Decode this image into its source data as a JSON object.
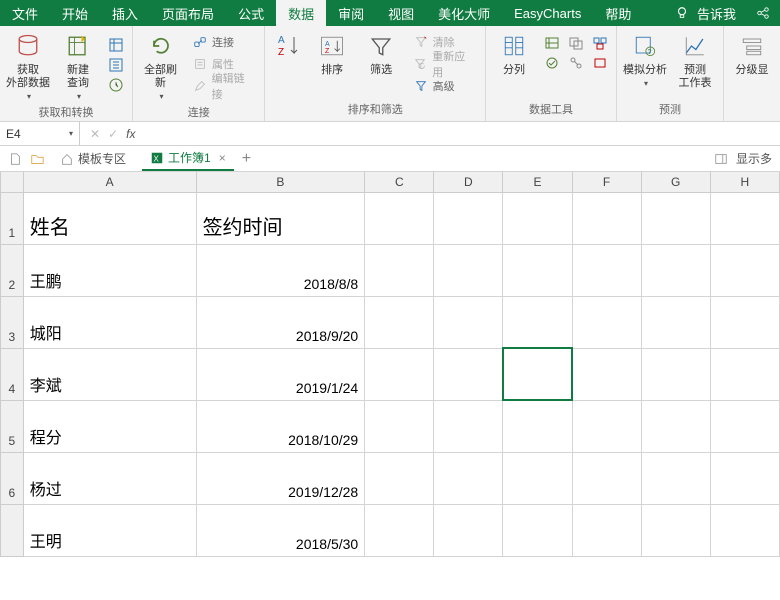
{
  "menu": {
    "tabs": [
      "文件",
      "开始",
      "插入",
      "页面布局",
      "公式",
      "数据",
      "审阅",
      "视图",
      "美化大师",
      "EasyCharts",
      "帮助"
    ],
    "active_index": 5,
    "tell_me": "告诉我"
  },
  "ribbon": {
    "group1": {
      "btn_external": "获取\n外部数据",
      "btn_newquery": "新建\n查询",
      "label": "获取和转换"
    },
    "group2": {
      "btn_refresh": "全部刷新",
      "itm_conn": "连接",
      "itm_prop": "属性",
      "itm_edit": "编辑链接",
      "label": "连接"
    },
    "group3": {
      "btn_sort": "排序",
      "btn_filter": "筛选",
      "itm_clear": "清除",
      "itm_reapply": "重新应用",
      "itm_adv": "高级",
      "label": "排序和筛选"
    },
    "group4": {
      "btn_split": "分列",
      "label": "数据工具"
    },
    "group5": {
      "btn_whatif": "模拟分析",
      "btn_forecast": "预测\n工作表",
      "label": "预测"
    },
    "group6": {
      "btn_group": "分级显",
      "label": ""
    }
  },
  "namebox": "E4",
  "doctabs": {
    "templates": "模板专区",
    "workbook": "工作簿1",
    "showmore": "显示多"
  },
  "columns": [
    "A",
    "B",
    "C",
    "D",
    "E",
    "F",
    "G",
    "H"
  ],
  "rows": [
    "1",
    "2",
    "3",
    "4",
    "5",
    "6"
  ],
  "cells": {
    "A1": "姓名",
    "B1": "签约时间",
    "A2": "王鹏",
    "B2": "2018/8/8",
    "A3": "城阳",
    "B3": "2018/9/20",
    "A4": "李斌",
    "B4": "2019/1/24",
    "A5": "程分",
    "B5": "2018/10/29",
    "A6": "杨过",
    "B6": "2019/12/28",
    "A7": "王明",
    "B7": "2018/5/30"
  },
  "selected_cell": "E4"
}
